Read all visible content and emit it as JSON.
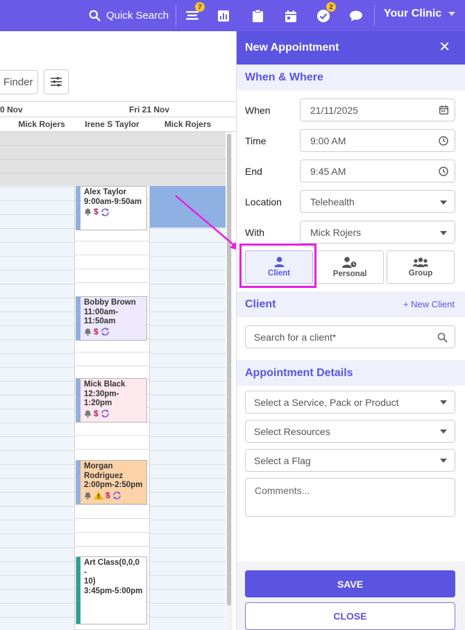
{
  "topbar": {
    "search_label": "Quick Search",
    "badges": {
      "feed": "7",
      "tasks": "2"
    },
    "clinic_label": "Your Clinic"
  },
  "calendar": {
    "finder_label": "Finder",
    "date_left": "0 Nov",
    "date_right": "Fri 21 Nov",
    "columns": [
      "Mick Rojers",
      "Irene S Taylor",
      "Mick Rojers"
    ],
    "appointments": [
      {
        "lines": [
          "Alex Taylor",
          "9:00am-9:50am"
        ],
        "color": "#ffffff",
        "bar": "#8fb0e2"
      },
      {
        "lines": [
          "Bobby Brown",
          "11:00am-",
          "11:50am"
        ],
        "color": "#ede8fb",
        "bar": "#8fb0e2"
      },
      {
        "lines": [
          "Mick Black",
          "12:30pm-",
          "1:20pm"
        ],
        "color": "#fde8ee",
        "bar": "#8fb0e2"
      },
      {
        "lines": [
          "Morgan",
          "Rodriguez",
          "2:00pm-2:50pm"
        ],
        "color": "#fcd3a9",
        "bar": "#8fb0e2"
      },
      {
        "lines": [
          "Art Class(0,0,0 -",
          "10)",
          "3:45pm-5:00pm"
        ],
        "color": "#ffffff",
        "bar": "#2aa198"
      }
    ]
  },
  "panel": {
    "title": "New Appointment",
    "sections": {
      "when_where": "When & Where",
      "client": "Client",
      "details": "Appointment Details"
    },
    "fields": {
      "when": {
        "label": "When",
        "value": "21/11/2025"
      },
      "time": {
        "label": "Time",
        "value": "9:00 AM"
      },
      "end": {
        "label": "End",
        "value": "9:45 AM"
      },
      "location": {
        "label": "Location",
        "value": "Telehealth"
      },
      "with": {
        "label": "With",
        "value": "Mick Rojers"
      }
    },
    "types": {
      "client": "Client",
      "personal": "Personal",
      "group": "Group"
    },
    "new_client": "+ New Client",
    "client_search_placeholder": "Search for a client*",
    "service_placeholder": "Select a Service, Pack or Product",
    "resources_placeholder": "Select Resources",
    "flag_placeholder": "Select a Flag",
    "comments_placeholder": "Comments...",
    "save": "SAVE",
    "close": "CLOSE"
  },
  "colors": {
    "primary": "#5b54e0",
    "topbar": "#6a5ae8",
    "highlight": "#e91ee6"
  }
}
